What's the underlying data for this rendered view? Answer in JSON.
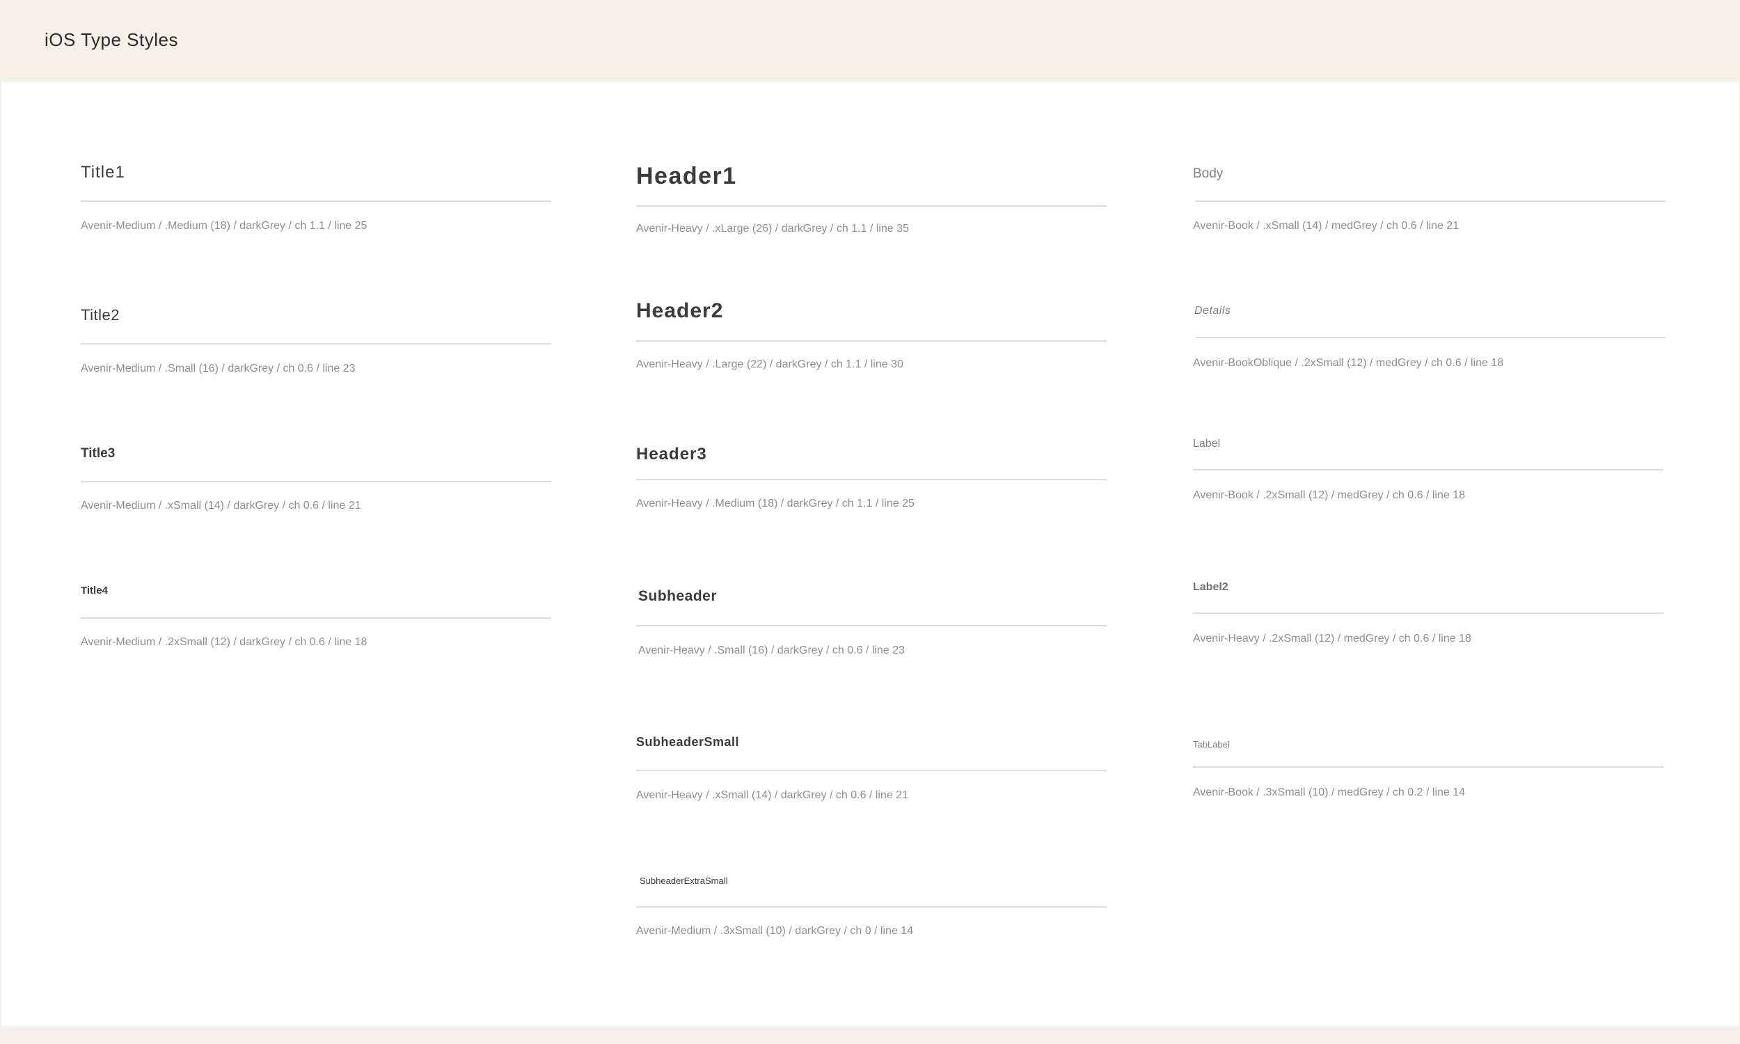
{
  "page": {
    "title": "iOS Type Styles"
  },
  "columns": [
    {
      "styles": [
        {
          "name": "Title1",
          "spec": "Avenir-Medium / .Medium (18)  / darkGrey / ch 1.1 / line 25"
        },
        {
          "name": "Title2",
          "spec": "Avenir-Medium / .Small  (16) / darkGrey / ch 0.6 / line 23"
        },
        {
          "name": "Title3",
          "spec": "Avenir-Medium / .xSmall (14) / darkGrey / ch 0.6 / line 21"
        },
        {
          "name": "Title4",
          "spec": "Avenir-Medium / .2xSmall (12) / darkGrey / ch 0.6 / line 18"
        }
      ]
    },
    {
      "styles": [
        {
          "name": "Header1",
          "spec": "Avenir-Heavy / .xLarge (26) / darkGrey / ch 1.1 / line 35"
        },
        {
          "name": "Header2",
          "spec": "Avenir-Heavy / .Large (22) / darkGrey / ch 1.1 / line 30"
        },
        {
          "name": "Header3",
          "spec": "Avenir-Heavy / .Medium (18) / darkGrey / ch 1.1 / line 25"
        },
        {
          "name": "Subheader",
          "spec": "Avenir-Heavy / .Small (16) / darkGrey / ch 0.6 / line 23"
        },
        {
          "name": "SubheaderSmall",
          "spec": "Avenir-Heavy / .xSmall (14) / darkGrey / ch 0.6 / line 21"
        },
        {
          "name": "SubheaderExtraSmall",
          "spec": "Avenir-Medium / .3xSmall (10) / darkGrey / ch 0 / line 14"
        }
      ]
    },
    {
      "styles": [
        {
          "name": "Body",
          "spec": "Avenir-Book / .xSmall (14) / medGrey / ch 0.6 / line 21"
        },
        {
          "name": "Details",
          "spec": "Avenir-BookOblique / .2xSmall (12) / medGrey / ch 0.6 / line 18"
        },
        {
          "name": "Label",
          "spec": "Avenir-Book / .2xSmall (12) / medGrey / ch 0.6 / line 18"
        },
        {
          "name": "Label2",
          "spec": "Avenir-Heavy / .2xSmall (12) / medGrey / ch 0.6 / line 18"
        },
        {
          "name": "TabLabel",
          "spec": "Avenir-Book / .3xSmall (10) / medGrey / ch 0.2 / line 14"
        }
      ]
    }
  ]
}
